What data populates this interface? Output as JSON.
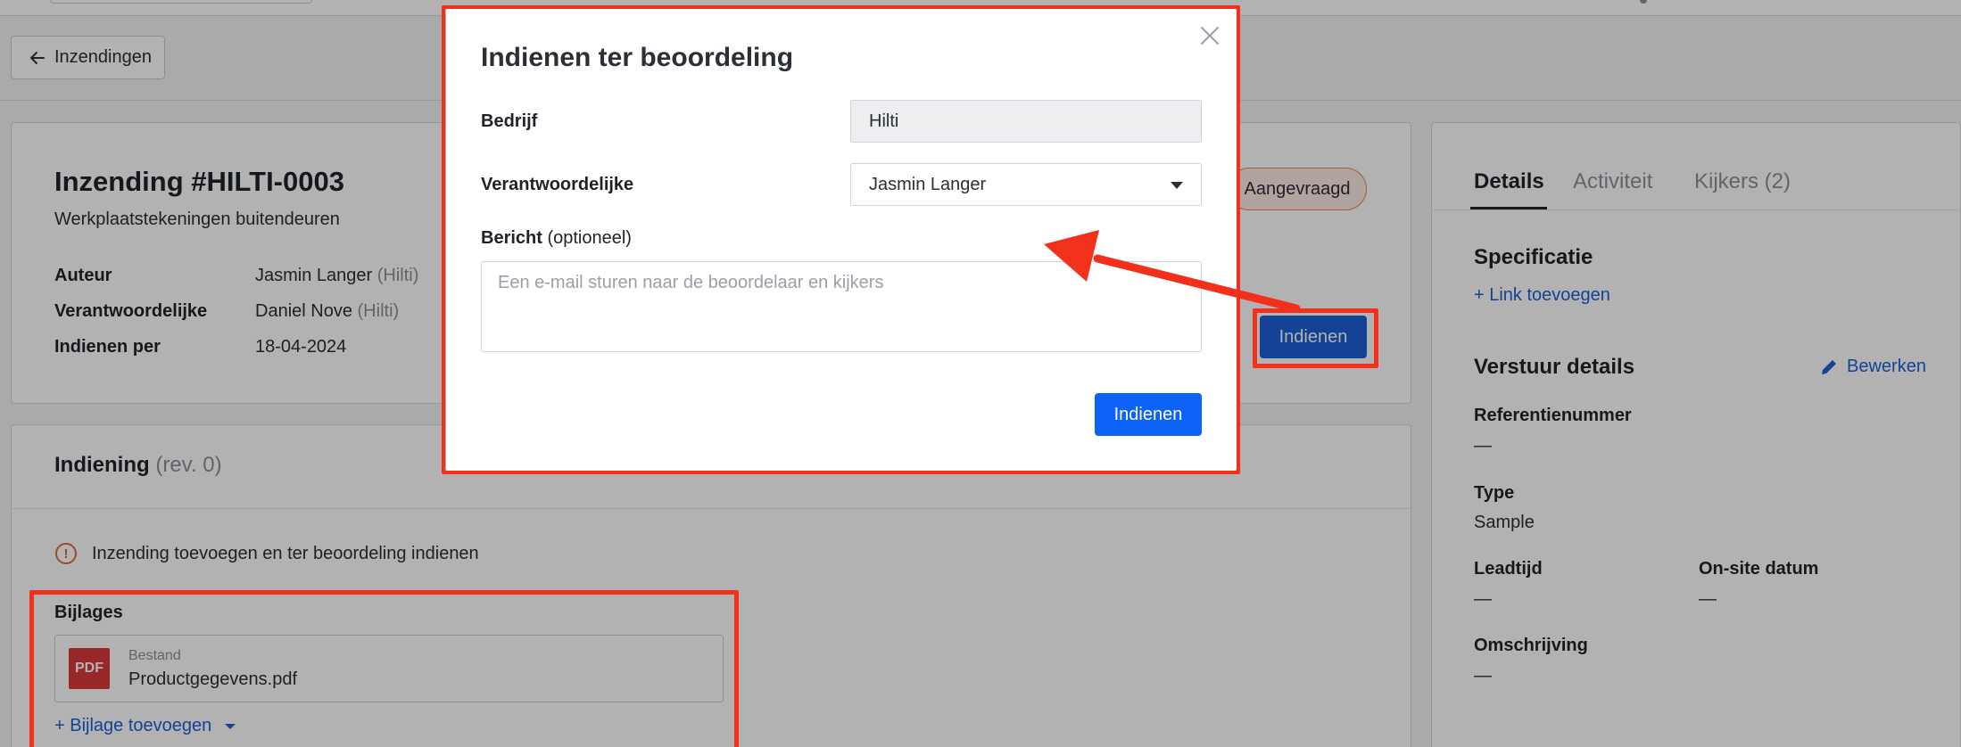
{
  "header": {
    "back_label": "Inzendingen"
  },
  "submission": {
    "title": "Inzending #HILTI-0003",
    "subtitle": "Werkplaatstekeningen buitendeuren",
    "status": "Aangevraagd",
    "submit_label": "Indienen",
    "fields": [
      {
        "label": "Auteur",
        "value": "Jasmin Langer",
        "org": "(Hilti)"
      },
      {
        "label": "Verantwoordelijke",
        "value": "Daniel Nove",
        "org": "(Hilti)"
      },
      {
        "label": "Indienen per",
        "value": "18-04-2024",
        "org": ""
      }
    ]
  },
  "indiening": {
    "title": "Indiening",
    "rev": "(rev. 0)",
    "notice": "Inzending toevoegen en ter beoordeling indienen",
    "attachments_label": "Bijlages",
    "file": {
      "type_label": "Bestand",
      "name": "Productgegevens.pdf",
      "badge": "PDF"
    },
    "add_attachment": "+ Bijlage toevoegen"
  },
  "right_panel": {
    "tabs": [
      {
        "label": "Details"
      },
      {
        "label": "Activiteit"
      },
      {
        "label": "Kijkers (2)"
      }
    ],
    "spec_title": "Specificatie",
    "add_link": "+ Link toevoegen",
    "send_title": "Verstuur details",
    "edit_label": "Bewerken",
    "reference_label": "Referentienummer",
    "reference_value": "—",
    "type_label": "Type",
    "type_value": "Sample",
    "leadtime_label": "Leadtijd",
    "leadtime_value": "—",
    "onsite_label": "On-site datum",
    "onsite_value": "—",
    "description_label": "Omschrijving",
    "description_value": "—"
  },
  "modal": {
    "title": "Indienen ter beoordeling",
    "company_label": "Bedrijf",
    "company_value": "Hilti",
    "responsible_label": "Verantwoordelijke",
    "responsible_value": "Jasmin Langer",
    "message_label": "Bericht",
    "message_optional": "(optioneel)",
    "message_placeholder": "Een e-mail sturen naar de beoordelaar en kijkers",
    "submit_label": "Indienen"
  },
  "colors": {
    "accent": "#1d5fd6",
    "highlight": "#f2311d",
    "warning": "#e06a3a",
    "pdf": "#d9393a"
  }
}
